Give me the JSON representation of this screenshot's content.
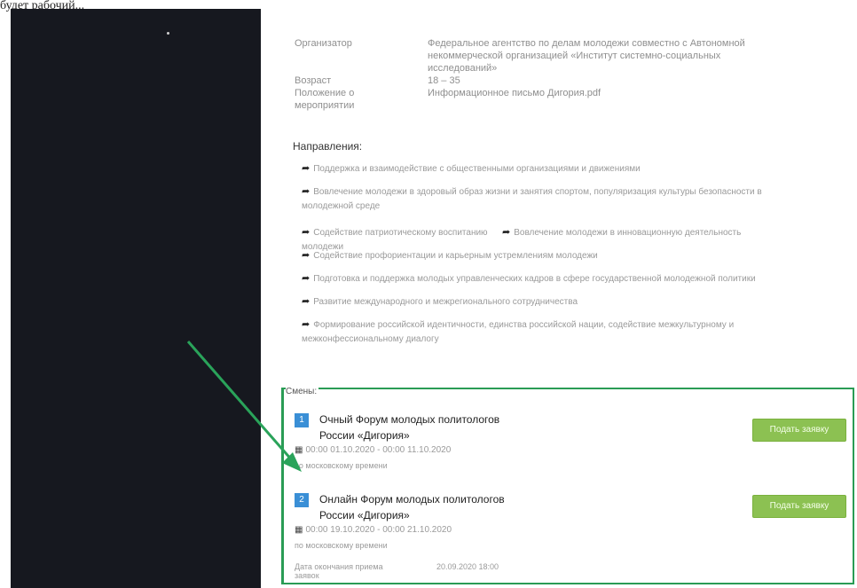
{
  "page_top_fragment": "будет рабочий...",
  "organizer": {
    "label": "Организатор",
    "value": "Федеральное агентство по делам молодежи совместно с Автономной некоммерческой организацией «Институт системно-социальных исследований»"
  },
  "age": {
    "label": "Возраст",
    "value": "18 – 35"
  },
  "regulation": {
    "label": "Положение о мероприятии",
    "value": "Информационное письмо Дигория.pdf"
  },
  "directions": {
    "title": "Направления:",
    "items": [
      "Поддержка и взаимодействие с общественными организациями и движениями",
      "Вовлечение молодежи в здоровый образ жизни и занятия спортом, популяризация культуры безопасности в молодежной среде",
      "Содействие патриотическому воспитанию молодежи",
      "Вовлечение молодежи в инновационную деятельность",
      "Содействие профориентации и карьерным устремлениям молодежи",
      "Подготовка и поддержка молодых управленческих кадров в сфере государственной молодежной политики",
      "Развитие международного и межрегионального сотрудничества",
      "Формирование российской идентичности, единства российской нации, содействие межкультурному и межконфессиональному диалогу"
    ]
  },
  "shifts": {
    "label": "Смены:",
    "items": [
      {
        "number": "1",
        "title_line1": "Очный Форум молодых политологов",
        "title_line2": "России «Дигория»",
        "dates": "00:00 01.10.2020 - 00:00 11.10.2020",
        "timezone": "по московскому времени",
        "button": "Подать заявку"
      },
      {
        "number": "2",
        "title_line1": "Онлайн Форум молодых политологов",
        "title_line2": "России «Дигория»",
        "dates": "00:00 19.10.2020 - 00:00 21.10.2020",
        "timezone": "по московскому времени",
        "button": "Подать заявку"
      }
    ],
    "bottom_label": "Дата окончания приема заявок",
    "bottom_value": "20.09.2020 18:00"
  },
  "colors": {
    "dark_panel": "#16181f",
    "highlight_box": "#2a9c55",
    "button": "#8cc152",
    "number_badge": "#3a8fd6"
  }
}
